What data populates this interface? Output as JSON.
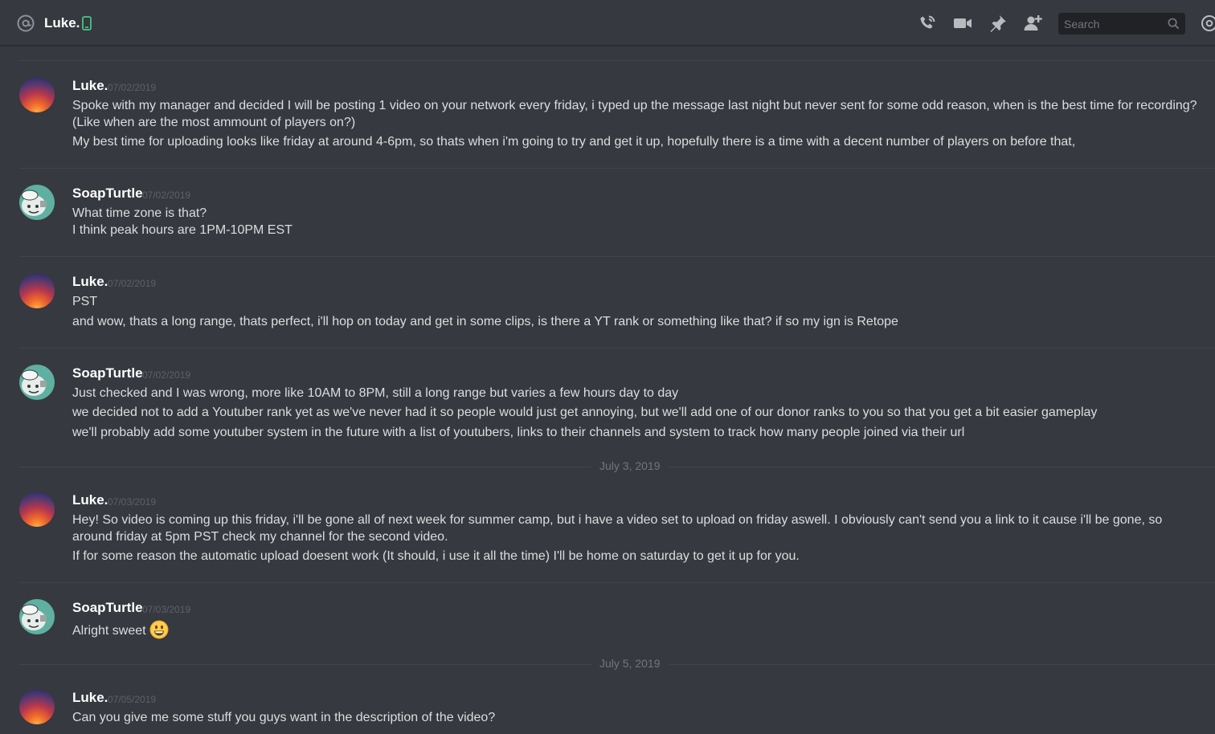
{
  "header": {
    "channel_name": "Luke.",
    "search_placeholder": "Search"
  },
  "colors": {
    "background": "#36393f",
    "username": "#ffffff",
    "text": "#dcddde",
    "timestamp": "#5d6067",
    "mobile_status": "#43b581"
  },
  "icons": [
    "at-icon",
    "mobile-status-icon",
    "voice-call-icon",
    "video-call-icon",
    "pin-icon",
    "add-friend-icon",
    "search-icon",
    "mention-icon"
  ],
  "messages": [
    {
      "author": "Luke.",
      "timestamp": "07/02/2019",
      "lines": [
        "Spoke with my manager and decided I will be posting 1 video on your network every friday, i typed up the message last night but never sent for some odd reason, when is the best time for recording? (Like when are the most ammount of players on?)",
        "My best time for uploading looks like friday at around 4-6pm, so thats when i'm going to try and get it up, hopefully there is a time with a decent number of players on before that,"
      ]
    },
    {
      "author": "SoapTurtle",
      "timestamp": "07/02/2019",
      "lines": [
        "What time zone is that?",
        "I think peak hours are 1PM-10PM EST"
      ]
    },
    {
      "author": "Luke.",
      "timestamp": "07/02/2019",
      "lines": [
        "PST",
        "and wow, thats a long range, thats perfect, i'll hop on today and get in some clips, is there a YT rank or something like that? if so my ign is Retope"
      ]
    },
    {
      "author": "SoapTurtle",
      "timestamp": "07/02/2019",
      "lines": [
        "Just checked and I was wrong, more like 10AM to 8PM, still a long range but varies a few hours day to day",
        "we decided not to add a Youtuber rank yet as we've never had it so people would just get annoying, but we'll add one of our donor ranks to you so that you get a bit easier gameplay",
        "we'll probably add some youtuber system in the future with a list of youtubers, links to their channels and system to track how many people joined via their url"
      ]
    },
    {
      "date_separator": "July 3, 2019"
    },
    {
      "author": "Luke.",
      "timestamp": "07/03/2019",
      "lines": [
        "Hey! So video is coming up this friday, i'll be gone all of next week for summer camp, but i have a video set to upload on friday aswell. I obviously can't send you a link to it cause i'll be gone, so around friday at 5pm PST check my channel for the second video.",
        "If for some reason the automatic upload doesent work (It should, i use it all the time) I'll be home on saturday to get it up for you."
      ]
    },
    {
      "author": "SoapTurtle",
      "timestamp": "07/03/2019",
      "lines": [
        "Alright sweet"
      ],
      "emoji": "smiley"
    },
    {
      "date_separator": "July 5, 2019"
    },
    {
      "author": "Luke.",
      "timestamp": "07/05/2019",
      "lines": [
        "Can you give me some stuff you guys want in the description of the video?"
      ]
    }
  ]
}
